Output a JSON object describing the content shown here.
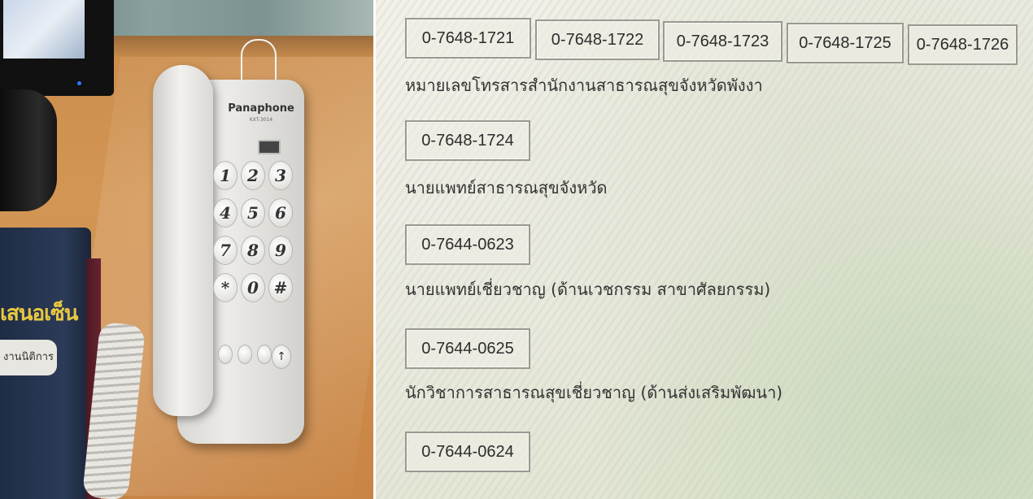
{
  "left_photo": {
    "phone_brand": "Panaphone",
    "phone_model": "KXT-3014",
    "keypad_keys": [
      "1",
      "2",
      "3",
      "4",
      "5",
      "6",
      "7",
      "8",
      "9",
      "*",
      "0",
      "#"
    ],
    "book_title": "เสนอเซ็น",
    "book_label": "งานนิติการ"
  },
  "screen": {
    "top_numbers": [
      "0-7648-1721",
      "0-7648-1722",
      "0-7648-1723",
      "0-7648-1725",
      "0-7648-1726"
    ],
    "entries": [
      {
        "label": "หมายเลขโทรสารสำนักงานสาธารณสุขจังหวัดพังงา",
        "number": "0-7648-1724"
      },
      {
        "label": "นายแพทย์สาธารณสุขจังหวัด",
        "number": "0-7644-0623"
      },
      {
        "label": "นายแพทย์เชี่ยวชาญ (ด้านเวชกรรม สาขาศัลยกรรม)",
        "number": "0-7644-0625"
      },
      {
        "label": "นักวิชาการสาธารณสุขเชี่ยวชาญ (ด้านส่งเสริมพัฒนา)",
        "number": "0-7644-0624"
      }
    ]
  }
}
